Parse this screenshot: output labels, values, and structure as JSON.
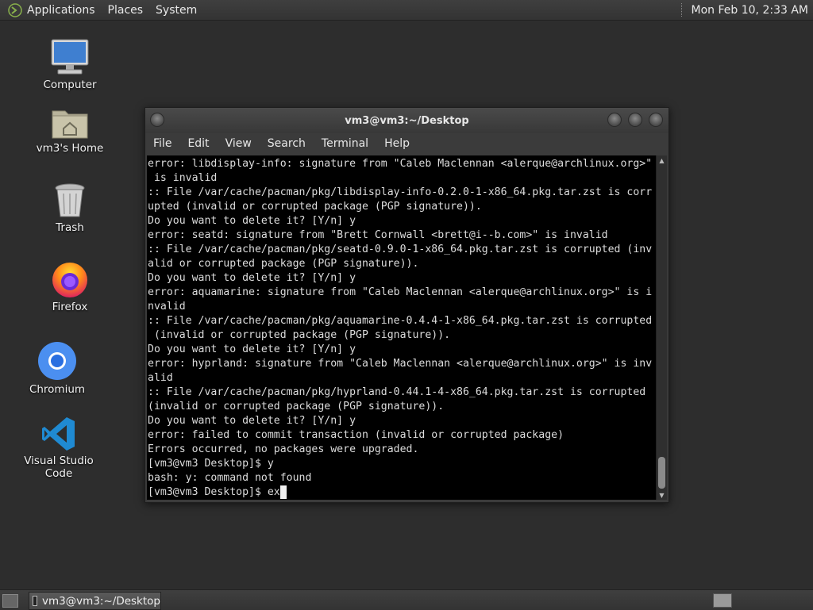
{
  "top_panel": {
    "menus": [
      "Applications",
      "Places",
      "System"
    ],
    "clock": "Mon Feb 10,  2:33 AM"
  },
  "desktop": {
    "icons": [
      {
        "label": "Computer",
        "icon": "computer-icon"
      },
      {
        "label": "vm3's Home",
        "icon": "home-folder-icon"
      },
      {
        "label": "Trash",
        "icon": "trash-icon"
      },
      {
        "label": "Firefox",
        "icon": "firefox-icon"
      },
      {
        "label": "Chromium",
        "icon": "chromium-icon"
      },
      {
        "label": "Visual Studio Code",
        "icon": "vscode-icon"
      }
    ]
  },
  "terminal": {
    "title": "vm3@vm3:~/Desktop",
    "menu": [
      "File",
      "Edit",
      "View",
      "Search",
      "Terminal",
      "Help"
    ],
    "lines": [
      "error: libdisplay-info: signature from \"Caleb Maclennan <alerque@archlinux.org>\"",
      " is invalid",
      ":: File /var/cache/pacman/pkg/libdisplay-info-0.2.0-1-x86_64.pkg.tar.zst is corr",
      "upted (invalid or corrupted package (PGP signature)).",
      "Do you want to delete it? [Y/n] y",
      "error: seatd: signature from \"Brett Cornwall <brett@i--b.com>\" is invalid",
      ":: File /var/cache/pacman/pkg/seatd-0.9.0-1-x86_64.pkg.tar.zst is corrupted (inv",
      "alid or corrupted package (PGP signature)).",
      "Do you want to delete it? [Y/n] y",
      "error: aquamarine: signature from \"Caleb Maclennan <alerque@archlinux.org>\" is i",
      "nvalid",
      ":: File /var/cache/pacman/pkg/aquamarine-0.4.4-1-x86_64.pkg.tar.zst is corrupted",
      " (invalid or corrupted package (PGP signature)).",
      "Do you want to delete it? [Y/n] y",
      "error: hyprland: signature from \"Caleb Maclennan <alerque@archlinux.org>\" is inv",
      "alid",
      ":: File /var/cache/pacman/pkg/hyprland-0.44.1-4-x86_64.pkg.tar.zst is corrupted",
      "(invalid or corrupted package (PGP signature)).",
      "Do you want to delete it? [Y/n] y",
      "error: failed to commit transaction (invalid or corrupted package)",
      "Errors occurred, no packages were upgraded.",
      "[vm3@vm3 Desktop]$ y",
      "bash: y: command not found"
    ],
    "prompt": "[vm3@vm3 Desktop]$ ",
    "current_input": "ex"
  },
  "bottom_panel": {
    "task_label": "vm3@vm3:~/Desktop"
  }
}
